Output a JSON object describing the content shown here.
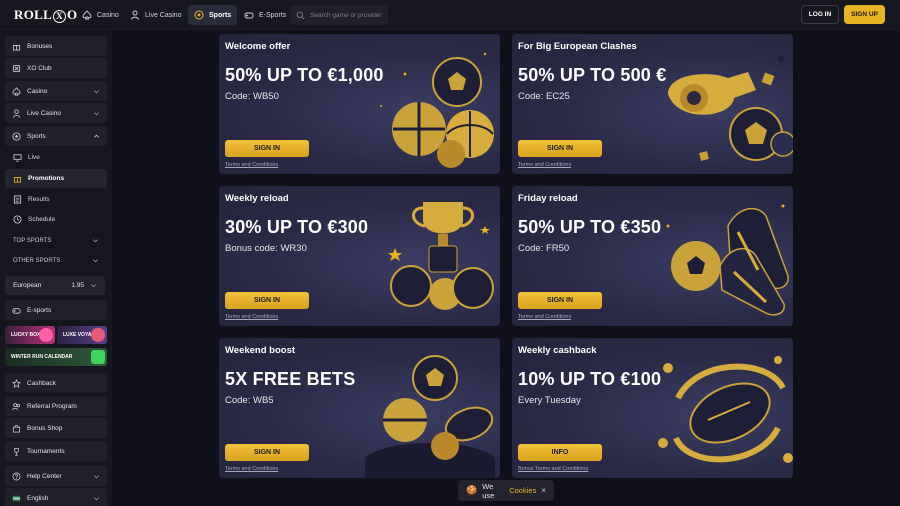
{
  "brand": {
    "logo_left": "ROLL",
    "logo_x": "X",
    "logo_right": "O"
  },
  "nav": [
    {
      "label": "Casino",
      "icon": "spade-icon"
    },
    {
      "label": "Live Casino",
      "icon": "dealer-icon"
    },
    {
      "label": "Sports",
      "icon": "soccer-ball-icon",
      "active": true
    },
    {
      "label": "E-Sports",
      "icon": "gamepad-icon"
    }
  ],
  "search": {
    "placeholder": "Search game or provider"
  },
  "auth": {
    "login": "LOG IN",
    "signup": "SIGN UP"
  },
  "sidebar": {
    "top_items": [
      {
        "label": "Bonuses",
        "icon": "gift-icon"
      },
      {
        "label": "XO Club",
        "icon": "club-icon"
      },
      {
        "label": "Casino",
        "icon": "spade-icon"
      },
      {
        "label": "Live Casino",
        "icon": "dealer-icon"
      },
      {
        "label": "Sports",
        "icon": "soccer-ball-icon"
      }
    ],
    "sports_sub": [
      {
        "label": "Live",
        "icon": "monitor-icon"
      },
      {
        "label": "Promotions",
        "icon": "gift-icon",
        "active": true
      },
      {
        "label": "Results",
        "icon": "list-icon"
      },
      {
        "label": "Schedule",
        "icon": "clock-icon"
      }
    ],
    "top_sports": "TOP SPORTS",
    "other_sports": "OTHER SPORTS",
    "odds_format": {
      "label": "European",
      "value": "1.95"
    },
    "esports": "E-sports",
    "promo_banners": [
      "LUCKY BOX",
      "LUXE VOYAGE",
      "WINTER RUN CALENDAR"
    ],
    "bottom_items": [
      {
        "label": "Cashback",
        "icon": "star-icon"
      },
      {
        "label": "Referral Program",
        "icon": "referral-icon"
      },
      {
        "label": "Bonus Shop",
        "icon": "shop-icon"
      },
      {
        "label": "Tournaments",
        "icon": "trophy-icon"
      },
      {
        "label": "Help Center",
        "icon": "help-icon"
      },
      {
        "label": "English",
        "icon": "flag-icon"
      }
    ]
  },
  "promos": [
    {
      "title": "Welcome offer",
      "amount": "50% UP TO €1,000",
      "code": "Code: WB50",
      "button": "SIGN IN",
      "terms": "Terms and Conditions"
    },
    {
      "title": "For Big European Clashes",
      "amount": "50% UP TO 500 €",
      "code": "Code: EC25",
      "button": "SIGN IN",
      "terms": "Terms and Conditions"
    },
    {
      "title": "Weekly reload",
      "amount": "30% UP TO €300",
      "code": "Bonus code: WR30",
      "button": "SIGN IN",
      "terms": "Terms and Conditions"
    },
    {
      "title": "Friday reload",
      "amount": "50% UP TO €350",
      "code": "Code: FR50",
      "button": "SIGN IN",
      "terms": "Terms and Conditions"
    },
    {
      "title": "Weekend boost",
      "amount": "5X FREE BETS",
      "code": "Code: WB5",
      "button": "SIGN IN",
      "terms": "Terms and Conditions"
    },
    {
      "title": "Weekly cashback",
      "amount": "10% UP TO €100",
      "code": "Every Tuesday",
      "button": "INFO",
      "terms": "Bonus Terms and Conditions"
    }
  ],
  "cookie": {
    "prefix": "We use",
    "link": "Cookies",
    "close": "×"
  },
  "colors": {
    "accent": "#e6b324",
    "card": "#2a2a47",
    "bg": "#0f1019"
  }
}
